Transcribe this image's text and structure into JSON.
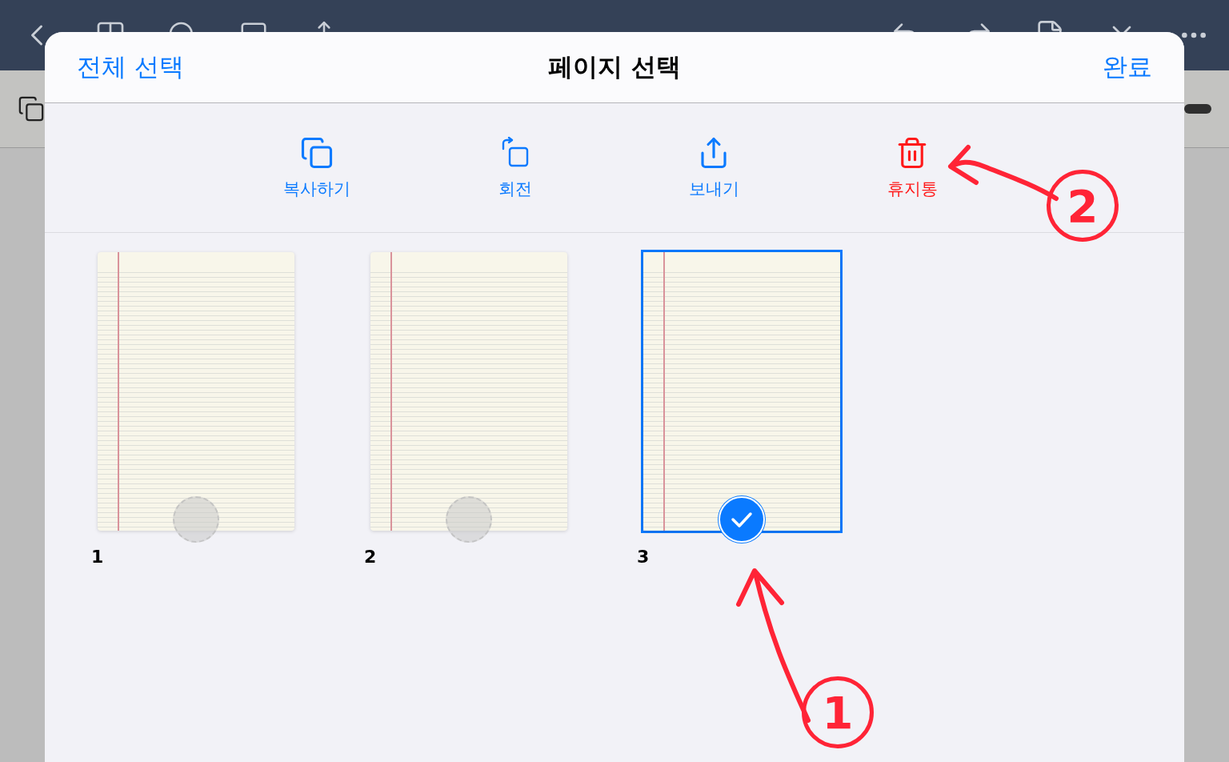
{
  "sheet": {
    "select_all": "전체 선택",
    "title": "페이지 선택",
    "done": "완료"
  },
  "actions": [
    {
      "kind": "copy",
      "label": "복사하기"
    },
    {
      "kind": "rotate",
      "label": "회전"
    },
    {
      "kind": "share",
      "label": "보내기"
    },
    {
      "kind": "trash",
      "label": "휴지통"
    }
  ],
  "pages": [
    {
      "number": "1",
      "selected": false
    },
    {
      "number": "2",
      "selected": false
    },
    {
      "number": "3",
      "selected": true
    }
  ],
  "annotations": [
    {
      "kind": "left",
      "number": "2"
    },
    {
      "kind": "up",
      "number": "1"
    }
  ]
}
